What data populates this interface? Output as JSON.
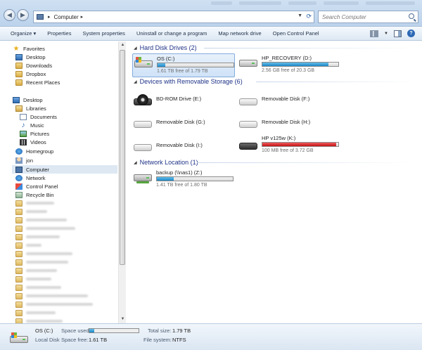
{
  "window": {
    "breadcrumb": [
      "Computer"
    ],
    "search_placeholder": "Search Computer"
  },
  "toolbar": {
    "organize": "Organize",
    "items": [
      "Properties",
      "System properties",
      "Uninstall or change a program",
      "Map network drive",
      "Open Control Panel"
    ]
  },
  "sidebar": {
    "favorites": {
      "label": "Favorites",
      "items": [
        "Desktop",
        "Downloads",
        "Dropbox",
        "Recent Places"
      ]
    },
    "desktop": "Desktop",
    "libraries": {
      "label": "Libraries",
      "items": [
        "Documents",
        "Music",
        "Pictures",
        "Videos"
      ]
    },
    "homegroup": "Homegroup",
    "user": "jon",
    "computer": "Computer",
    "network": "Network",
    "control_panel": "Control Panel",
    "recycle_bin": "Recycle Bin"
  },
  "groups": {
    "hard_disks": "Hard Disk Drives (2)",
    "removable": "Devices with Removable Storage (6)",
    "network": "Network Location (1)"
  },
  "drives": {
    "os": {
      "name": "OS (C:)",
      "info": "1.61 TB free of 1.79 TB",
      "used_fraction": 0.1
    },
    "recovery": {
      "name": "HP_RECOVERY (D:)",
      "info": "2.56 GB free of 20.3 GB",
      "used_fraction": 0.87
    },
    "bdrom": {
      "name": "BD-ROM Drive (E:)"
    },
    "remF": {
      "name": "Removable Disk (F:)"
    },
    "remG": {
      "name": "Removable Disk (G:)"
    },
    "remH": {
      "name": "Removable Disk (H:)"
    },
    "remI": {
      "name": "Removable Disk (I:)"
    },
    "hp": {
      "name": "HP v125w (K:)",
      "info": "100 MB free of 3.72 GB",
      "used_fraction": 0.97
    },
    "backup": {
      "name": "backup (\\\\nas1) (Z:)",
      "info": "1.41 TB free of 1.80 TB",
      "used_fraction": 0.22
    }
  },
  "details": {
    "name": "OS (C:)",
    "type": "Local Disk",
    "space_used_label": "Space used:",
    "space_free_label": "Space free:",
    "space_free": "1.61 TB",
    "total_size_label": "Total size:",
    "total_size": "1.79 TB",
    "file_system_label": "File system:",
    "file_system": "NTFS",
    "used_fraction": 0.1
  }
}
